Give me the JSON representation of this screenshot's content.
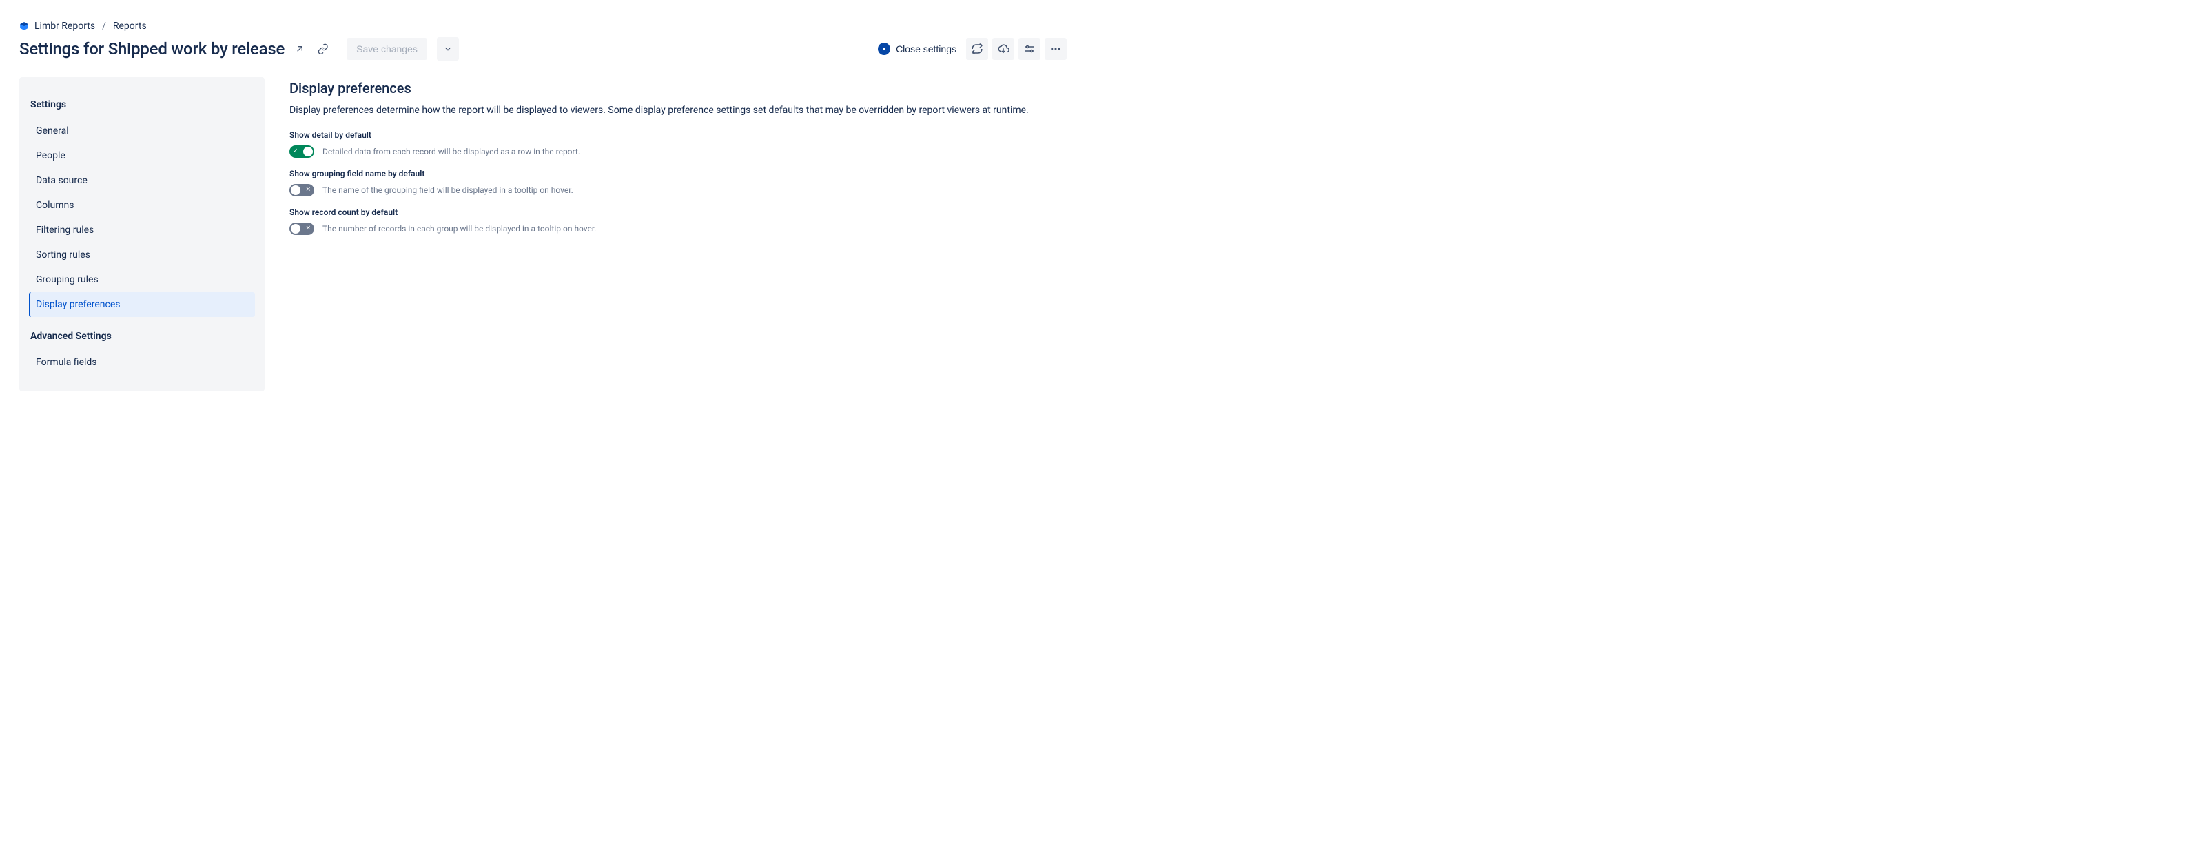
{
  "breadcrumbs": {
    "project": "Limbr Reports",
    "section": "Reports"
  },
  "title": {
    "prefix": "Settings for ",
    "name": "Shipped work by release"
  },
  "actions": {
    "save_label": "Save changes",
    "close_label": "Close settings"
  },
  "sidebar": {
    "heading_main": "Settings",
    "heading_advanced": "Advanced Settings",
    "items": [
      {
        "label": "General",
        "active": false
      },
      {
        "label": "People",
        "active": false
      },
      {
        "label": "Data source",
        "active": false
      },
      {
        "label": "Columns",
        "active": false
      },
      {
        "label": "Filtering rules",
        "active": false
      },
      {
        "label": "Sorting rules",
        "active": false
      },
      {
        "label": "Grouping rules",
        "active": false
      },
      {
        "label": "Display preferences",
        "active": true
      }
    ],
    "advanced_items": [
      {
        "label": "Formula fields",
        "active": false
      }
    ]
  },
  "main": {
    "title": "Display preferences",
    "description": "Display preferences determine how the report will be displayed to viewers. Some display preference settings set defaults that may be overridden by report viewers at runtime.",
    "fields": [
      {
        "label": "Show detail by default",
        "enabled": true,
        "help": "Detailed data from each record will be displayed as a row in the report."
      },
      {
        "label": "Show grouping field name by default",
        "enabled": false,
        "help": "The name of the grouping field will be displayed in a tooltip on hover."
      },
      {
        "label": "Show record count by default",
        "enabled": false,
        "help": "The number of records in each group will be displayed in a tooltip on hover."
      }
    ]
  }
}
